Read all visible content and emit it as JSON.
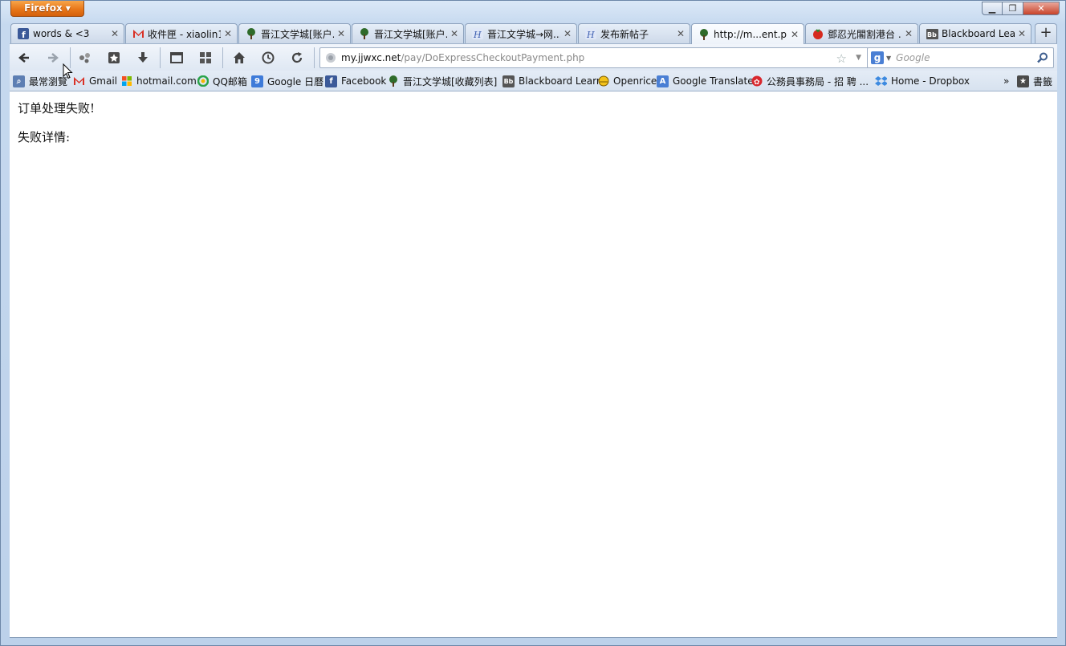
{
  "window": {
    "app_button": "Firefox",
    "caption": {
      "minimize": "▁",
      "maximize": "❐",
      "close": "✕"
    }
  },
  "tabs": [
    {
      "label": "words & <3",
      "icon": "facebook-icon",
      "active": false
    },
    {
      "label": "收件匣 - xiaolin1...",
      "icon": "gmail-icon",
      "active": false
    },
    {
      "label": "晋江文学城[账户...",
      "icon": "jjwxc-icon",
      "active": false
    },
    {
      "label": "晋江文学城[账户...",
      "icon": "jjwxc-icon",
      "active": false
    },
    {
      "label": "晋江文学城→网...",
      "icon": "jjwxc-forum-icon",
      "active": false
    },
    {
      "label": "发布新帖子",
      "icon": "jjwxc-forum-icon",
      "active": false
    },
    {
      "label": "http://m...ent.php",
      "icon": "jjwxc-icon",
      "active": true
    },
    {
      "label": "鄧忍光閣割港台 ...",
      "icon": "tomato-icon",
      "active": false
    },
    {
      "label": "Blackboard Learn",
      "icon": "blackboard-icon",
      "active": false
    }
  ],
  "new_tab": "+",
  "urlbar": {
    "host": "my.jjwxc.net",
    "path": "/pay/DoExpressCheckoutPayment.php"
  },
  "search": {
    "engine": "g",
    "placeholder": "Google"
  },
  "bookmarks": [
    {
      "label": "最常瀏覽",
      "icon": "most-visited-icon"
    },
    {
      "label": "Gmail",
      "icon": "gmail-icon"
    },
    {
      "label": "hotmail.com",
      "icon": "windows-icon"
    },
    {
      "label": "QQ邮箱",
      "icon": "qq-icon"
    },
    {
      "label": "Google 日曆",
      "icon": "google-calendar-icon"
    },
    {
      "label": "Facebook",
      "icon": "facebook-icon"
    },
    {
      "label": "晋江文学城[收藏列表]",
      "icon": "jjwxc-icon"
    },
    {
      "label": "Blackboard Learn",
      "icon": "blackboard-icon"
    },
    {
      "label": "Openrice",
      "icon": "openrice-icon"
    },
    {
      "label": "Google Translate",
      "icon": "google-translate-icon"
    },
    {
      "label": "公務員事務局 - 招 聘 ...",
      "icon": "hk-gov-icon"
    },
    {
      "label": "Home - Dropbox",
      "icon": "dropbox-icon"
    }
  ],
  "bookmarks_overflow": "»",
  "bookmarks_menu": "書籤",
  "page": {
    "line1": "订单处理失败!",
    "line2": "失败详情:"
  },
  "colors": {
    "firefox_orange": "#e8771a",
    "facebook_blue": "#3b5998",
    "gmail_red": "#d93025"
  }
}
